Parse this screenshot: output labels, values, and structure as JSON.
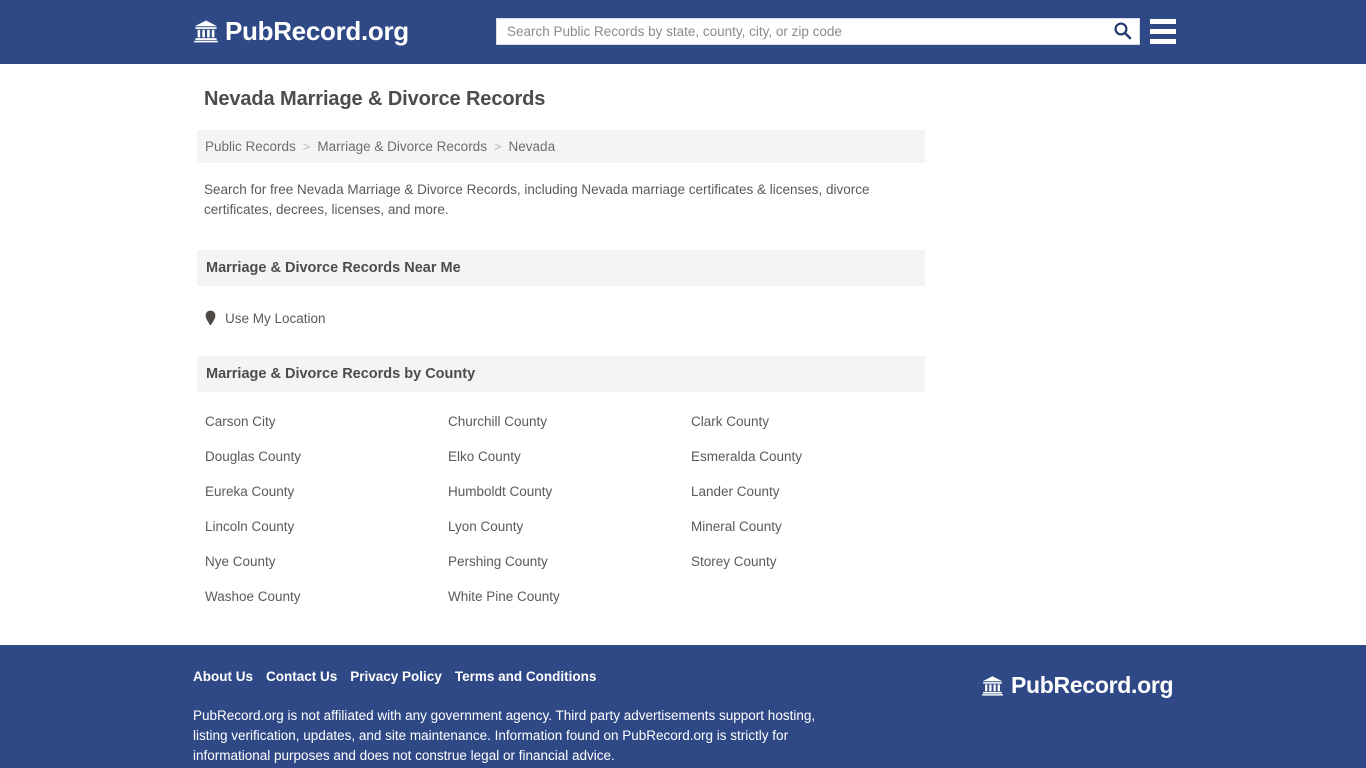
{
  "colors": {
    "brand_blue": "#2F4886",
    "band_gray": "#F4F4F5",
    "text_gray": "#5A5A5A",
    "heading_gray": "#4C4C4C",
    "page_background": "#FFFFFF"
  },
  "header": {
    "logo_icon": "bank-building-icon",
    "logo_text": "PubRecord.org",
    "search": {
      "value": "",
      "placeholder": "Search Public Records by state, county, city, or zip code",
      "search_icon": "search-icon"
    },
    "menu_icon": "hamburger-menu-icon"
  },
  "main": {
    "title": "Nevada Marriage & Divorce Records",
    "breadcrumb": {
      "items": [
        {
          "label": "Public Records"
        },
        {
          "label": "Marriage & Divorce Records"
        },
        {
          "label": "Nevada"
        }
      ],
      "separator": ">"
    },
    "intro": "Search for free Nevada Marriage & Divorce Records, including Nevada marriage certificates & licenses, divorce certificates, decrees, licenses, and more.",
    "near_me": {
      "heading": "Marriage & Divorce Records Near Me",
      "pin_icon": "map-pin-icon",
      "use_location_label": "Use My Location"
    },
    "by_county": {
      "heading": "Marriage & Divorce Records by County",
      "counties": [
        "Carson City",
        "Churchill County",
        "Clark County",
        "Douglas County",
        "Elko County",
        "Esmeralda County",
        "Eureka County",
        "Humboldt County",
        "Lander County",
        "Lincoln County",
        "Lyon County",
        "Mineral County",
        "Nye County",
        "Pershing County",
        "Storey County",
        "Washoe County",
        "White Pine County"
      ]
    }
  },
  "footer": {
    "links": [
      "About Us",
      "Contact Us",
      "Privacy Policy",
      "Terms and Conditions"
    ],
    "disclaimer": "PubRecord.org is not affiliated with any government agency. Third party advertisements support hosting, listing verification, updates, and site maintenance. Information found on PubRecord.org is strictly for informational purposes and does not construe legal or financial advice.",
    "logo_icon": "bank-building-icon",
    "logo_text": "PubRecord.org"
  }
}
